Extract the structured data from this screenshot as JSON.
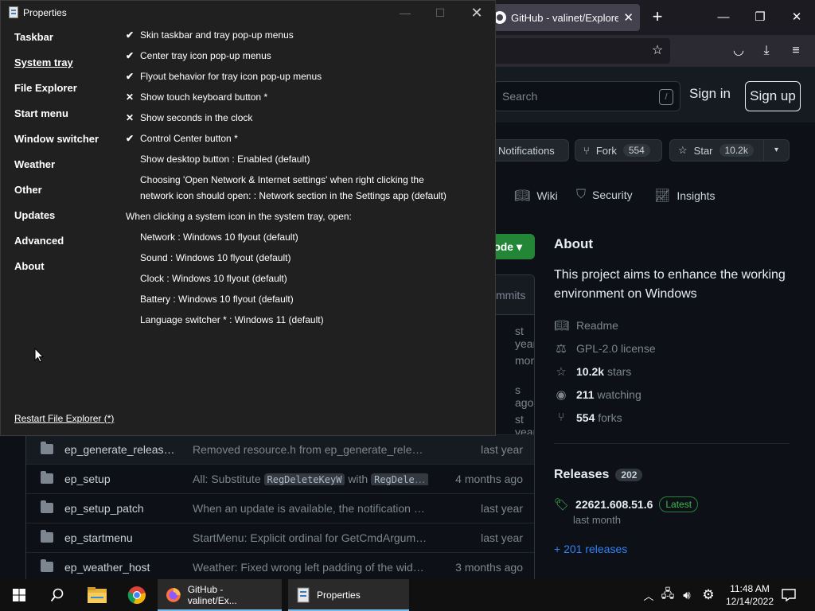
{
  "browser": {
    "tab_title": "GitHub - valinet/ExplorerP…",
    "tab_close": "✕",
    "new_tab": "+",
    "window_min": "—",
    "window_max": "❐",
    "window_close": "✕"
  },
  "github": {
    "search_placeholder": "Search",
    "search_shortcut": "/",
    "sign_in": "Sign in",
    "sign_up": "Sign up",
    "notifications_label": "Notifications",
    "fork_label": "Fork",
    "fork_count": "554",
    "star_label": "Star",
    "star_count": "10.2k",
    "repo_tabs": [
      {
        "label": "Wiki",
        "icon": "book-icon"
      },
      {
        "label": "Security",
        "icon": "shield-icon"
      },
      {
        "label": "Insights",
        "icon": "graph-icon"
      }
    ],
    "code_button": "ode",
    "commits_label": "mmits",
    "peek_dates": [
      "st year",
      "month",
      "s ago",
      "st year"
    ],
    "files": [
      {
        "name": "ep_generate_release_…",
        "message": "Removed resource.h from ep_generate_release…",
        "date": "last year"
      },
      {
        "name": "ep_setup",
        "message_prefix": "All: Substitute",
        "chip1": "RegDeleteKeyW",
        "message_mid": "with",
        "chip2": "RegDelet…",
        "date": "4 months ago"
      },
      {
        "name": "ep_setup_patch",
        "message": "When an update is available, the notification di…",
        "date": "last year"
      },
      {
        "name": "ep_startmenu",
        "message": "StartMenu: Explicit ordinal for GetCmdArgume…",
        "date": "last year"
      },
      {
        "name": "ep_weather_host",
        "message": "Weather: Fixed wrong left padding of the widget",
        "date": "3 months ago"
      }
    ],
    "about": {
      "title": "About",
      "description": "This project aims to enhance the working environment on Windows",
      "readme": "Readme",
      "license": "GPL-2.0 license",
      "stars_count": "10.2k",
      "stars_label": "stars",
      "watching_count": "211",
      "watching_label": "watching",
      "forks_count": "554",
      "forks_label": "forks"
    },
    "releases": {
      "title": "Releases",
      "count": "202",
      "latest_name": "22621.608.51.6",
      "latest_badge": "Latest",
      "latest_date": "last month",
      "more": "+ 201 releases"
    }
  },
  "properties": {
    "title": "Properties",
    "nav": [
      "Taskbar",
      "System tray",
      "File Explorer",
      "Start menu",
      "Window switcher",
      "Weather",
      "Other",
      "Updates",
      "Advanced",
      "About"
    ],
    "active_nav": "System tray",
    "options": [
      {
        "mark": "✔",
        "text": "Skin taskbar and tray pop-up menus"
      },
      {
        "mark": "✔",
        "text": "Center tray icon pop-up menus"
      },
      {
        "mark": "✔",
        "text": "Flyout behavior for tray icon pop-up menus"
      },
      {
        "mark": "✕",
        "text": "Show touch keyboard button *"
      },
      {
        "mark": "✕",
        "text": "Show seconds in the clock"
      },
      {
        "mark": "✔",
        "text": "Control Center button *"
      }
    ],
    "show_desktop": "Show desktop button : Enabled (default)",
    "network_line1": "Choosing 'Open Network & Internet settings' when right clicking the",
    "network_line2": "network icon should open: : Network section in the Settings app (default)",
    "systray_heading": "When clicking a system icon in the system tray, open:",
    "systray_items": [
      "Network : Windows 10 flyout (default)",
      "Sound : Windows 10 flyout (default)",
      "Clock : Windows 10 flyout (default)",
      "Battery : Windows 10 flyout (default)",
      "Language switcher * : Windows 11 (default)"
    ],
    "restart_link": "Restart File Explorer (*)"
  },
  "taskbar": {
    "apps": [
      {
        "label": "GitHub - valinet/Ex...",
        "icon": "firefox-icon"
      },
      {
        "label": "Properties",
        "icon": "properties-icon"
      }
    ],
    "time": "11:48 AM",
    "date": "12/14/2022"
  }
}
